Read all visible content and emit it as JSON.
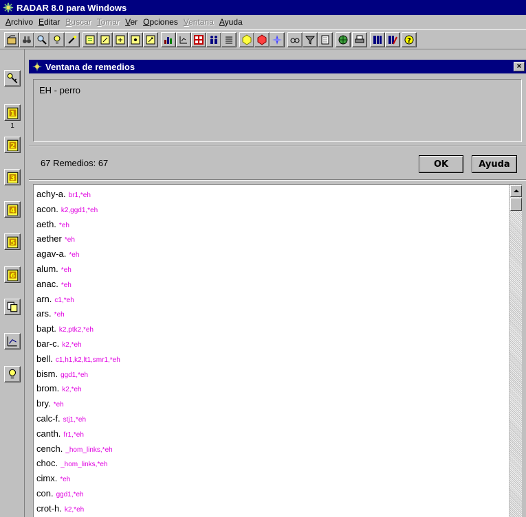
{
  "app": {
    "title": "RADAR 8.0 para Windows"
  },
  "menu": [
    {
      "label": "Archivo",
      "disabled": false
    },
    {
      "label": "Editar",
      "disabled": false
    },
    {
      "label": "Buscar",
      "disabled": true
    },
    {
      "label": "Tomar",
      "disabled": true
    },
    {
      "label": "Ver",
      "disabled": false
    },
    {
      "label": "Opciones",
      "disabled": false
    },
    {
      "label": "Ventana",
      "disabled": true
    },
    {
      "label": "Ayuda",
      "disabled": false
    }
  ],
  "toolbar_icons": [
    "open-icon",
    "binoculars-icon",
    "magnifier-icon",
    "bulb-icon",
    "wand-icon",
    "notebook-icon",
    "notebook-edit-icon",
    "notebook-add-icon",
    "notebook-view-icon",
    "notebook-search-icon",
    "bar-chart-icon",
    "chart-settings-icon",
    "grid-icon",
    "people-icon",
    "list-icon",
    "yellow-hex-icon",
    "red-hex-icon",
    "blue-compass-icon",
    "glasses-icon",
    "filter-icon",
    "document-icon",
    "globe-icon",
    "printer-icon",
    "columns-icon",
    "columns-edit-icon",
    "help-icon"
  ],
  "sidebar": {
    "buttons": [
      {
        "icon": "key-icon"
      },
      {
        "icon": "notebook-1-icon",
        "caption": "1"
      },
      {
        "icon": "notebook-2-icon"
      },
      {
        "icon": "notebook-3-icon"
      },
      {
        "icon": "notebook-4-icon"
      },
      {
        "icon": "notebook-5-icon"
      },
      {
        "icon": "notebook-6-icon"
      },
      {
        "icon": "copy-icon"
      },
      {
        "icon": "chart-edit-icon"
      },
      {
        "icon": "bulb-icon"
      }
    ]
  },
  "window": {
    "title": "Ventana de remedios",
    "query": "EH - perro",
    "count_text": "67 Remedios: 67",
    "ok_label": "OK",
    "help_label": "Ayuda"
  },
  "remedies": [
    {
      "name": "achy-a.",
      "sources": "br1,*eh"
    },
    {
      "name": "acon.",
      "sources": "k2,ggd1,*eh"
    },
    {
      "name": "aeth.",
      "sources": "*eh"
    },
    {
      "name": "aether",
      "sources": "*eh"
    },
    {
      "name": "agav-a.",
      "sources": "*eh"
    },
    {
      "name": "alum.",
      "sources": "*eh"
    },
    {
      "name": "anac.",
      "sources": "*eh"
    },
    {
      "name": "arn.",
      "sources": "c1,*eh"
    },
    {
      "name": "ars.",
      "sources": "*eh"
    },
    {
      "name": "bapt.",
      "sources": "k2,ptk2,*eh"
    },
    {
      "name": "bar-c.",
      "sources": "k2,*eh"
    },
    {
      "name": "bell.",
      "sources": "c1,h1,k2,lt1,smr1,*eh"
    },
    {
      "name": "bism.",
      "sources": "ggd1,*eh"
    },
    {
      "name": "brom.",
      "sources": "k2,*eh"
    },
    {
      "name": "bry.",
      "sources": "*eh"
    },
    {
      "name": "calc-f.",
      "sources": "stj1,*eh"
    },
    {
      "name": "canth.",
      "sources": "fr1,*eh"
    },
    {
      "name": "cench.",
      "sources": "_hom_links,*eh"
    },
    {
      "name": "choc.",
      "sources": "_hom_links,*eh"
    },
    {
      "name": "cimx.",
      "sources": "*eh"
    },
    {
      "name": "con.",
      "sources": "ggd1,*eh"
    },
    {
      "name": "crot-h.",
      "sources": "k2,*eh"
    }
  ]
}
